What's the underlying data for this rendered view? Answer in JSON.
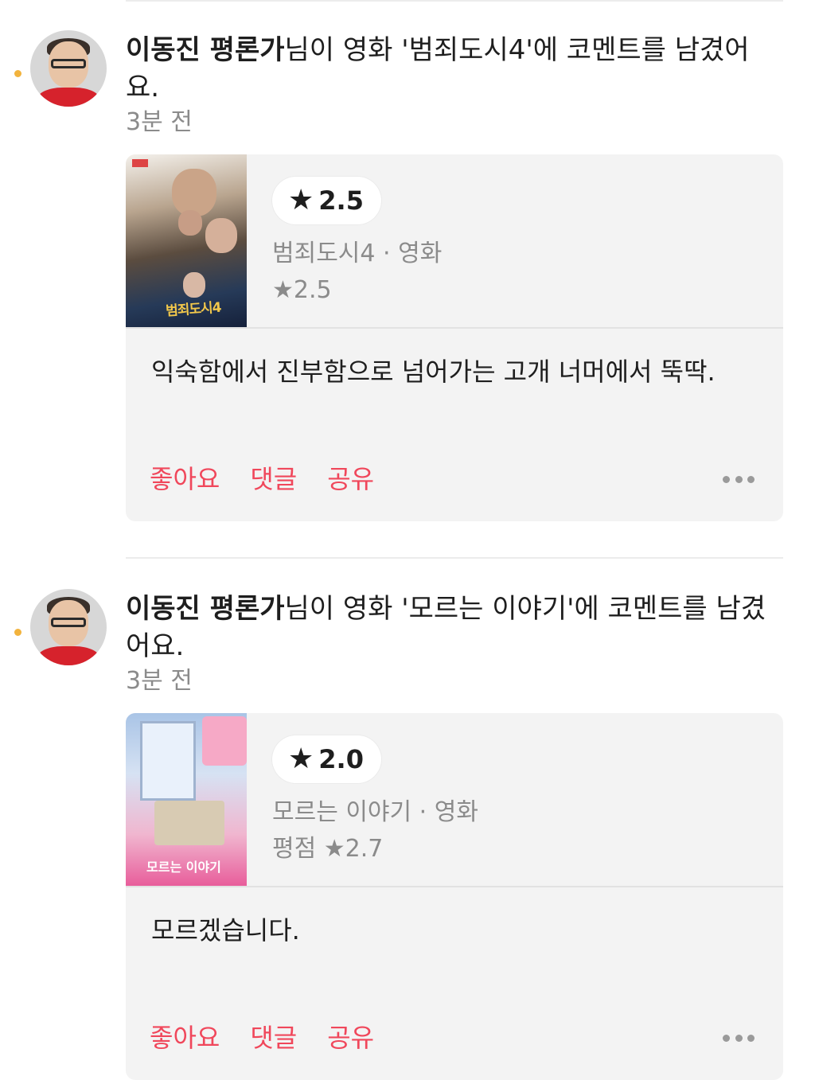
{
  "feed": {
    "items": [
      {
        "author": "이동진 평론가",
        "action_text": "님이 영화 '범죄도시4'에 코멘트를 남겼어요.",
        "time": "3분 전",
        "my_rating": "2.5",
        "movie_meta": "범죄도시4 · 영화",
        "avg_rating_label": "",
        "avg_rating": "★2.5",
        "poster_title": "범죄도시4",
        "comment": "익숙함에서 진부함으로 넘어가는 고개 너머에서 뚝딱.",
        "actions": {
          "like": "좋아요",
          "comment": "댓글",
          "share": "공유"
        }
      },
      {
        "author": "이동진 평론가",
        "action_text": "님이 영화 '모르는 이야기'에 코멘트를 남겼어요.",
        "time": "3분 전",
        "my_rating": "2.0",
        "movie_meta": "모르는 이야기 · 영화",
        "avg_rating_label": "평점",
        "avg_rating": "★2.7",
        "poster_title": "모르는 이야기",
        "comment": "모르겠습니다.",
        "actions": {
          "like": "좋아요",
          "comment": "댓글",
          "share": "공유"
        }
      }
    ]
  },
  "icons": {
    "star": "★",
    "more": "more-horizontal-icon",
    "unread": "unread-dot"
  },
  "colors": {
    "accent": "#f0475b",
    "unread_dot": "#f2b33d",
    "card_bg": "#f3f3f3",
    "muted_text": "#8b8b8b"
  }
}
